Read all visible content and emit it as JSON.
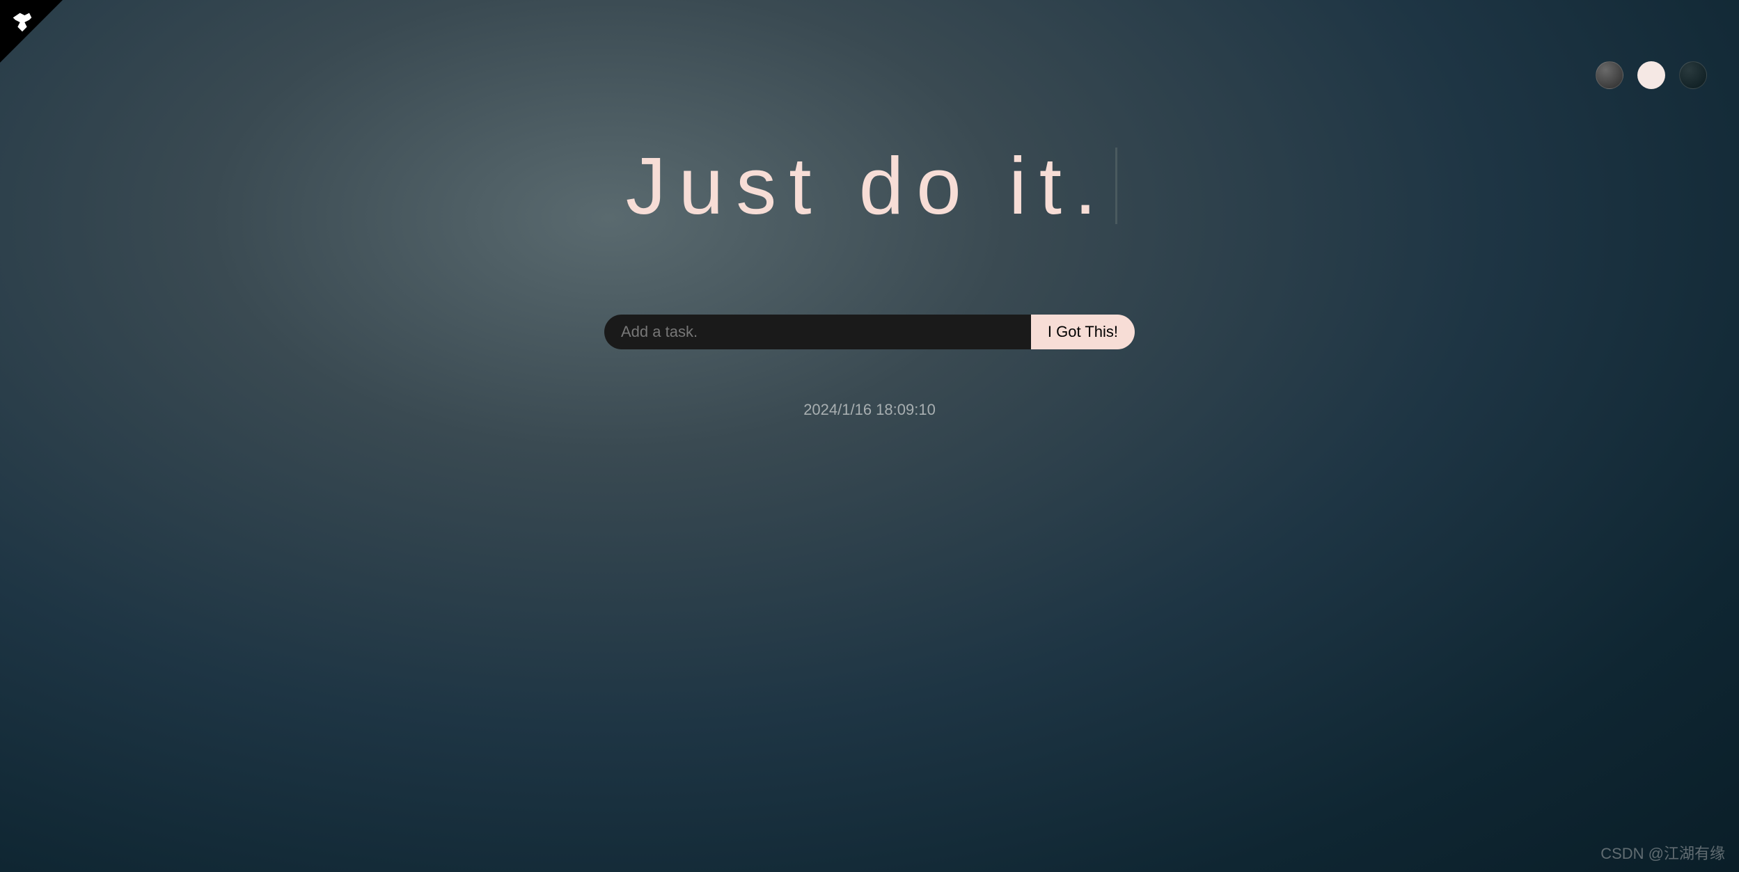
{
  "heading": "Just do it.",
  "task": {
    "placeholder": "Add a task.",
    "button_label": "I Got This!"
  },
  "timestamp": "2024/1/16 18:09:10",
  "watermark": "CSDN @江湖有缘",
  "themes": {
    "option1": "gray-gradient",
    "option2": "light",
    "option3": "dark-teal"
  }
}
